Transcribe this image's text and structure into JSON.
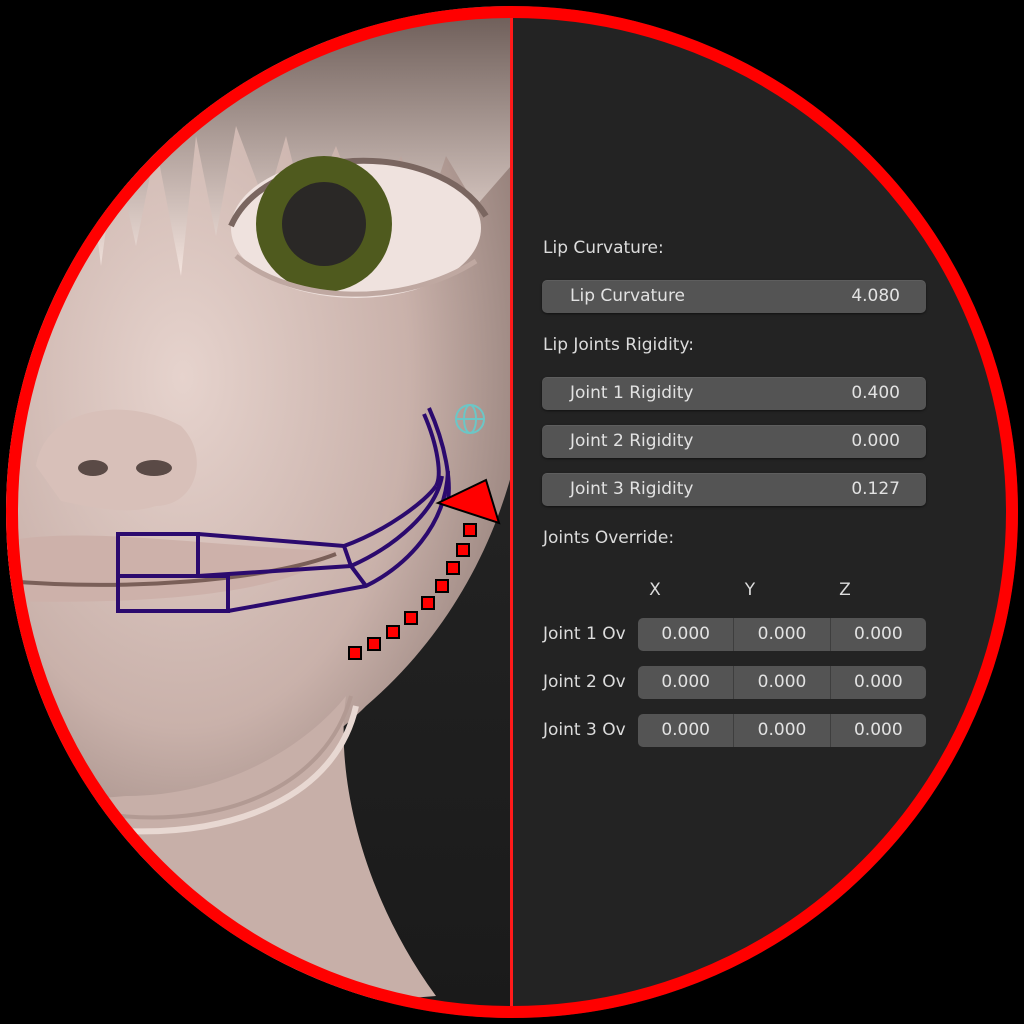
{
  "panel": {
    "lip_curvature_header": "Lip Curvature:",
    "lip_curvature": {
      "label": "Lip Curvature",
      "value": "4.080"
    },
    "rigidity_header": "Lip Joints Rigidity:",
    "rigidity": [
      {
        "label": "Joint 1 Rigidity",
        "value": "0.400"
      },
      {
        "label": "Joint 2 Rigidity",
        "value": "0.000"
      },
      {
        "label": "Joint 3 Rigidity",
        "value": "0.127"
      }
    ],
    "override_header": "Joints Override:",
    "axes": [
      "X",
      "Y",
      "Z"
    ],
    "overrides": [
      {
        "label": "Joint 1 Ov",
        "x": "0.000",
        "y": "0.000",
        "z": "0.000"
      },
      {
        "label": "Joint 2 Ov",
        "x": "0.000",
        "y": "0.000",
        "z": "0.000"
      },
      {
        "label": "Joint 3 Ov",
        "x": "0.000",
        "y": "0.000",
        "z": "0.000"
      }
    ]
  },
  "colors": {
    "ring": "#ff0000",
    "rig": "#2b0a6e",
    "arrow": "#ff0000",
    "skin": "#d9c3bd",
    "iris": "#4f5a1e"
  }
}
